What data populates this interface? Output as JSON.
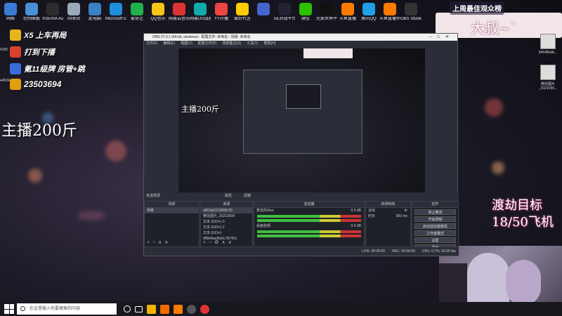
{
  "desktop_icons": [
    {
      "label": "网络",
      "color": "#3a7bd5"
    },
    {
      "label": "控制面板",
      "color": "#4a90d9"
    },
    {
      "label": "XSERIA Audio",
      "color": "#2d2d2d"
    },
    {
      "label": "回收站",
      "color": "#9ab"
    },
    {
      "label": "此电脑",
      "color": "#3b82c4"
    },
    {
      "label": "Microsoft Edge",
      "color": "#1d8fdb"
    },
    {
      "label": "爱奇艺",
      "color": "#22b14c"
    },
    {
      "label": "QQ音乐",
      "color": "#f5c518"
    },
    {
      "label": "网易云音乐",
      "color": "#d33"
    },
    {
      "label": "网易UU加速器",
      "color": "#1aa"
    },
    {
      "label": "YY开播",
      "color": "#e44"
    },
    {
      "label": "爱好代言",
      "color": "#ffcc00"
    },
    {
      "label": "",
      "color": "#4466cc"
    },
    {
      "label": "5E对战平台",
      "color": "#223"
    },
    {
      "label": "微信",
      "color": "#2dc100"
    },
    {
      "label": "完美世界平台",
      "color": "#111"
    },
    {
      "label": "斗鱼直播",
      "color": "#ff7a00"
    },
    {
      "label": "腾讯QQ",
      "color": "#1ea0e6"
    },
    {
      "label": "斗鱼直播伴侣",
      "color": "#ff7a00"
    },
    {
      "label": "OBS Studio",
      "color": "#333"
    }
  ],
  "left_labels": [
    "4182",
    "e4524"
  ],
  "ranks": [
    {
      "text": "X5 上车再局",
      "color": "#e8b61a"
    },
    {
      "text": "打到下播",
      "color": "#d9412b"
    },
    {
      "text": "氪11级牌 房管+跳",
      "color": "#3b6ad9"
    },
    {
      "text": "23503694",
      "color": "#e0a010"
    }
  ],
  "big_text_1": "主播200斤",
  "big_text_2": "主播200斤",
  "banner": "上周最佳观众榜",
  "name_box": "大叔~`",
  "promo_1": "渡劫目标",
  "promo_2": "18/50飞机",
  "right_icons": [
    "9454f6efb...",
    "微信图片_2021090..."
  ],
  "obs": {
    "title": "OBS 27.0.1 (64-bit, windows) - 配置文件: 未命名 - 场景: 未命名",
    "menu": [
      "文件(F)",
      "编辑(E)",
      "视图(V)",
      "配置文件(P)",
      "场景集合(S)",
      "工具(T)",
      "帮助(H)"
    ],
    "scene_bar": "未选择源",
    "props_btn": "属性",
    "filters_btn": "滤镜",
    "docks": {
      "scenes": {
        "title": "场景",
        "items": [
          "场景"
        ]
      },
      "sources": {
        "title": "来源",
        "items": [
          "af82ab2213980.00",
          "微信图片_20210909",
          "文本 (GDI+) 3",
          "文本 (GDI+) 2",
          "文本 (GDI+)",
          "9f8b4bad5e0c787451"
        ]
      },
      "mixer": {
        "title": "混音器",
        "channels": [
          {
            "name": "麦克风/Aux",
            "db": "0.0 dB"
          },
          {
            "name": "桌面音频",
            "db": "0.0 dB"
          }
        ]
      },
      "transitions": {
        "title": "转场特效",
        "type": "淡出",
        "duration_label": "时长",
        "duration": "300 ms"
      },
      "controls": {
        "title": "控件",
        "buttons": [
          "停止推流",
          "开始录制",
          "启动虚拟摄像机",
          "工作室模式",
          "设置",
          "退出"
        ]
      }
    },
    "status": {
      "live": "LIVE: 00:00:00",
      "rec": "REC: 00:00:00",
      "cpu": "CPU: 0.7%, 60.00 fps"
    }
  },
  "taskbar": {
    "search_placeholder": "在这里输入你要搜索的内容",
    "apps": [
      "#f0b400",
      "#f06a00",
      "#ff7a00",
      "#555",
      "#d33"
    ]
  }
}
